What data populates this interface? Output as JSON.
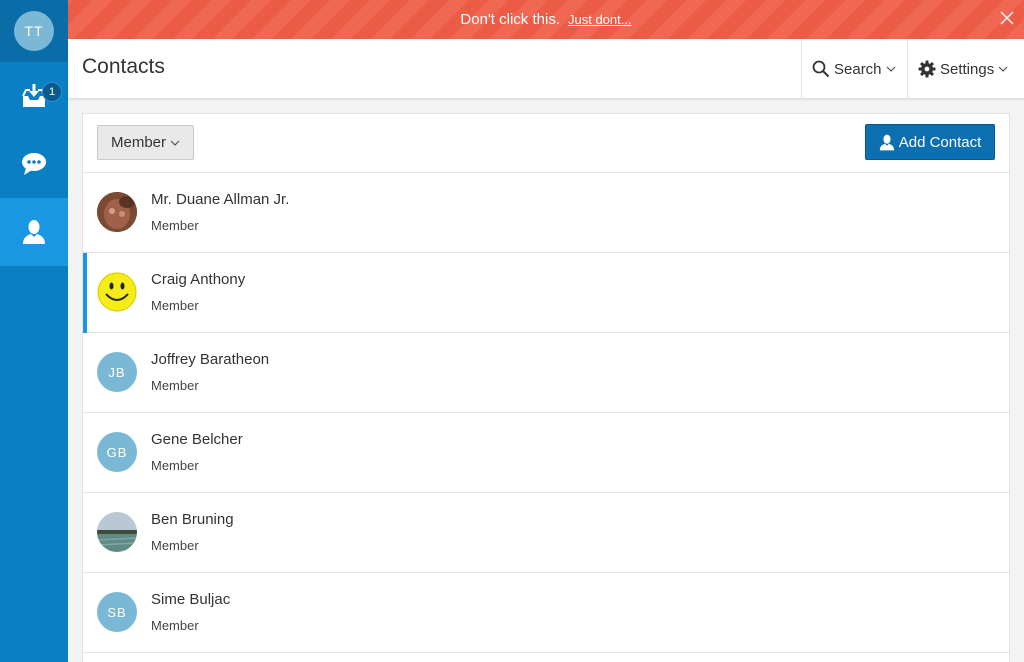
{
  "sidebar": {
    "user_initials": "TT",
    "inbox_badge": "1",
    "items": [
      {
        "name": "inbox-icon"
      },
      {
        "name": "chat-icon"
      },
      {
        "name": "contacts-icon"
      }
    ]
  },
  "banner": {
    "message": "Don't click this.",
    "link_text": "Just dont...",
    "color": "#ec5b46"
  },
  "header": {
    "title": "Contacts",
    "search_label": "Search",
    "settings_label": "Settings"
  },
  "toolbar": {
    "filter_label": "Member",
    "add_label": "Add Contact",
    "accent": "#0b6fb0"
  },
  "contacts": [
    {
      "name": "Mr. Duane Allman Jr.",
      "role": "Member",
      "avatar": "photo-portrait"
    },
    {
      "name": "Craig Anthony",
      "role": "Member",
      "avatar": "smiley-face",
      "selected": true
    },
    {
      "name": "Joffrey Baratheon",
      "role": "Member",
      "initials": "JB"
    },
    {
      "name": "Gene Belcher",
      "role": "Member",
      "initials": "GB"
    },
    {
      "name": "Ben Bruning",
      "role": "Member",
      "avatar": "photo-landscape"
    },
    {
      "name": "Sime Buljac",
      "role": "Member",
      "initials": "SB"
    }
  ]
}
